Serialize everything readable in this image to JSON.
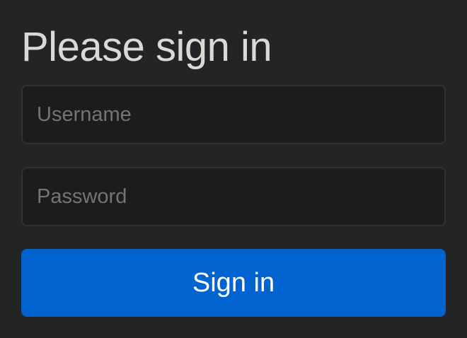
{
  "form": {
    "title": "Please sign in",
    "username": {
      "value": "",
      "placeholder": "Username"
    },
    "password": {
      "value": "",
      "placeholder": "Password"
    },
    "submit_label": "Sign in"
  },
  "colors": {
    "background": "#232426",
    "field_background": "#1b1c1d",
    "field_border": "#2f3133",
    "title_text": "#dcd9d4",
    "placeholder_text": "#77736d",
    "button_background": "#0063cf",
    "button_text": "#ffffff"
  }
}
